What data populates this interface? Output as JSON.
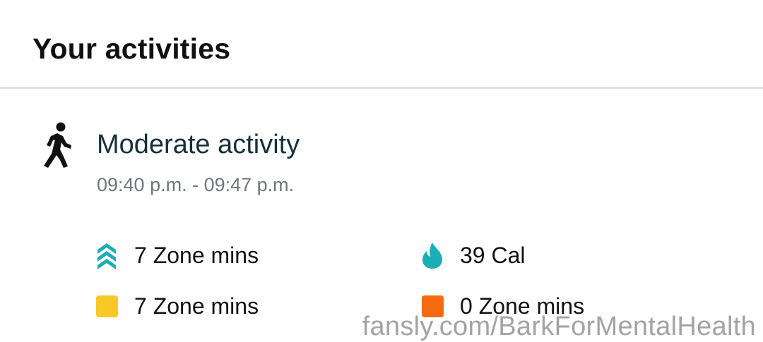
{
  "header": {
    "title": "Your activities"
  },
  "activity": {
    "icon": "walking-person-icon",
    "name": "Moderate activity",
    "time": "09:40 p.m. - 09:47 p.m."
  },
  "stats": {
    "zone_peak": {
      "icon": "chevrons-up-icon",
      "label": "7 Zone mins",
      "color": "#1aaeb6"
    },
    "calories": {
      "icon": "flame-icon",
      "label": "39 Cal",
      "color": "#1aaeb6"
    },
    "zone_cardio": {
      "icon": "yellow-square-icon",
      "label": "7 Zone mins",
      "color": "#f7c927"
    },
    "zone_fatburn": {
      "icon": "orange-square-icon",
      "label": "0 Zone mins",
      "color": "#f36a0f"
    }
  },
  "watermark": {
    "text": "fansly.com/BarkForMentalHealth"
  }
}
